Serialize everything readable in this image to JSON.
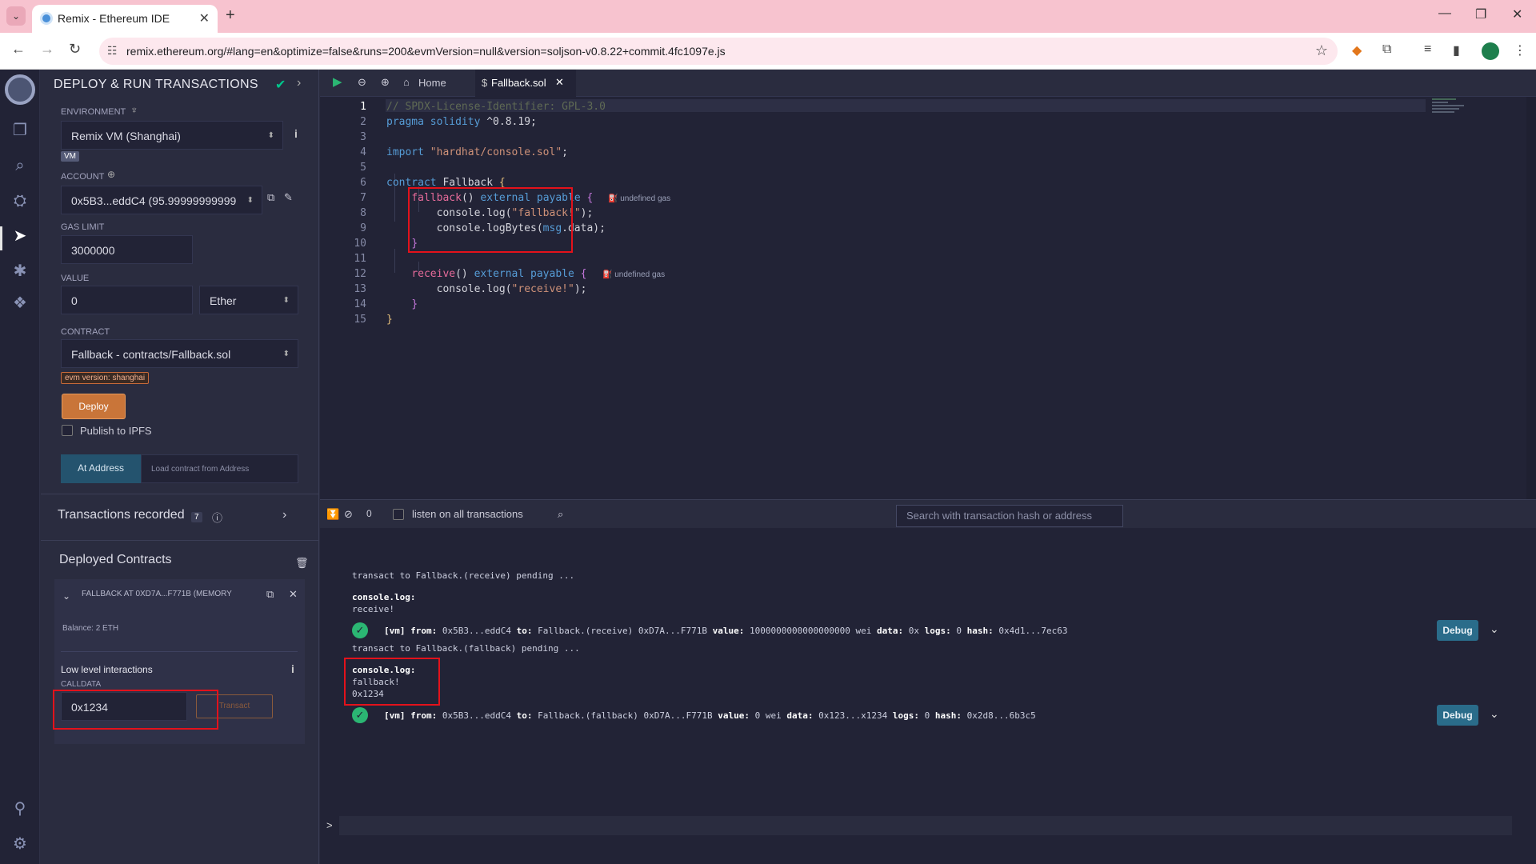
{
  "browser": {
    "tab_title": "Remix - Ethereum IDE",
    "url": "remix.ethereum.org/#lang=en&optimize=false&runs=200&evmVersion=null&version=soljson-v0.8.22+commit.4fc1097e.js"
  },
  "sidepanel": {
    "title": "DEPLOY & RUN TRANSACTIONS",
    "environment_label": "ENVIRONMENT",
    "environment_value": "Remix VM (Shanghai)",
    "vm_badge": "VM",
    "account_label": "ACCOUNT",
    "account_value": "0x5B3...eddC4 (95.99999999999",
    "gas_limit_label": "GAS LIMIT",
    "gas_limit_value": "3000000",
    "value_label": "VALUE",
    "value_amount": "0",
    "value_unit": "Ether",
    "contract_label": "CONTRACT",
    "contract_value": "Fallback - contracts/Fallback.sol",
    "evm_badge": "evm version: shanghai",
    "deploy_label": "Deploy",
    "publish_ipfs_label": "Publish to IPFS",
    "at_address_label": "At Address",
    "load_contract_placeholder": "Load contract from Address",
    "transactions_recorded_label": "Transactions recorded",
    "transactions_recorded_count": "7",
    "deployed_contracts_label": "Deployed Contracts",
    "deployed_instance": "FALLBACK AT 0XD7A...F771B (MEMORY",
    "balance": "Balance: 2 ETH",
    "low_level_label": "Low level interactions",
    "calldata_label": "CALLDATA",
    "calldata_value": "0x1234",
    "transact_label": "Transact"
  },
  "editor": {
    "home_tab": "Home",
    "file_tab": "Fallback.sol",
    "gas_hint": "undefined gas",
    "line_numbers": [
      "1",
      "2",
      "3",
      "4",
      "5",
      "6",
      "7",
      "8",
      "9",
      "10",
      "11",
      "12",
      "13",
      "14",
      "15"
    ]
  },
  "terminal": {
    "counter": "0",
    "listen_label": "listen on all transactions",
    "search_placeholder": "Search with transaction hash or address",
    "pending_receive": "transact to Fallback.(receive) pending ...",
    "console_log_label": "console.log:",
    "receive_output": "receive!",
    "tx1": {
      "vm": "[vm]",
      "from_label": "from:",
      "from": "0x5B3...eddC4",
      "to_label": "to:",
      "to": "Fallback.(receive) 0xD7A...F771B",
      "value_label": "value:",
      "value": "1000000000000000000 wei",
      "data_label": "data:",
      "data": "0x",
      "logs_label": "logs:",
      "logs": "0",
      "hash_label": "hash:",
      "hash": "0x4d1...7ec63"
    },
    "pending_fallback": "transact to Fallback.(fallback) pending ...",
    "fallback_output_1": "fallback!",
    "fallback_output_2": "0x1234",
    "tx2": {
      "vm": "[vm]",
      "from_label": "from:",
      "from": "0x5B3...eddC4",
      "to_label": "to:",
      "to": "Fallback.(fallback) 0xD7A...F771B",
      "value_label": "value:",
      "value": "0 wei",
      "data_label": "data:",
      "data": "0x123...x1234",
      "logs_label": "logs:",
      "logs": "0",
      "hash_label": "hash:",
      "hash": "0x2d8...6b3c5"
    },
    "debug_label": "Debug",
    "prompt": ">"
  },
  "colors": {
    "accent_red_box": "#e3121b",
    "deploy_button": "#c97539",
    "success": "#2bb673"
  }
}
